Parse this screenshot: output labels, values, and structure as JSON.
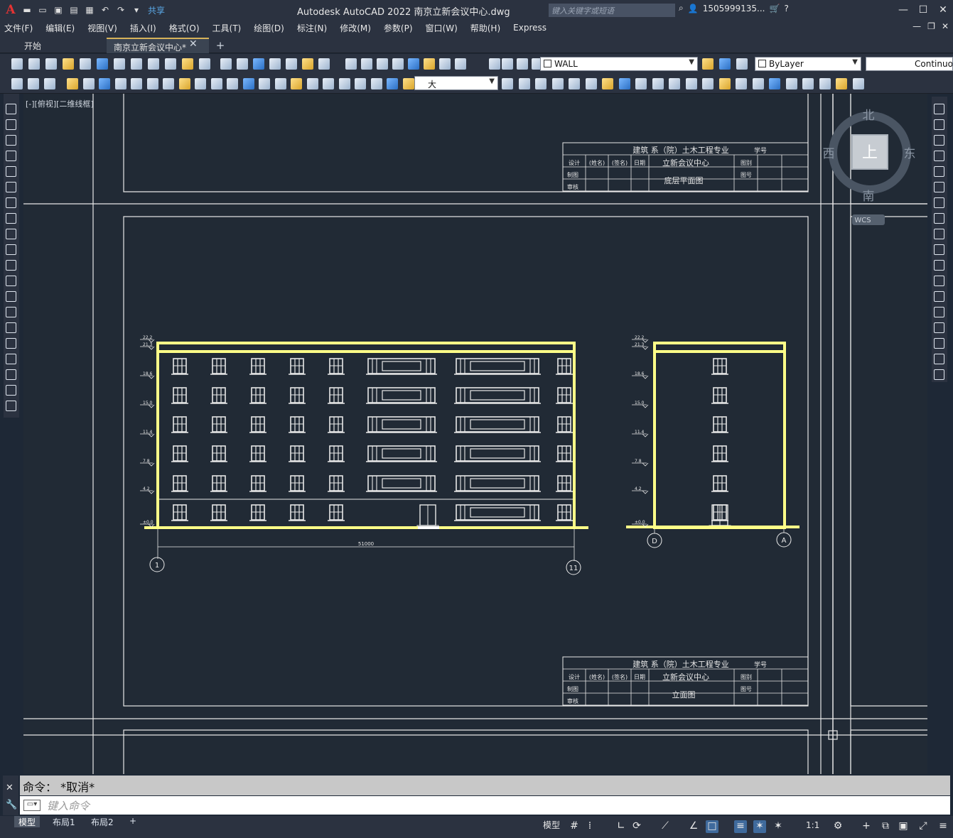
{
  "window": {
    "title": "Autodesk AutoCAD 2022    南京立新会议中心.dwg",
    "search_placeholder": "键入关键字或短语",
    "user": "1505999135...",
    "share": "共享"
  },
  "menu": [
    "文件(F)",
    "编辑(E)",
    "视图(V)",
    "插入(I)",
    "格式(O)",
    "工具(T)",
    "绘图(D)",
    "标注(N)",
    "修改(M)",
    "参数(P)",
    "窗口(W)",
    "帮助(H)",
    "Express"
  ],
  "tabs": {
    "start": "开始",
    "active": "南京立新会议中心*"
  },
  "toolbar": {
    "layer": "WALL",
    "color": "ByLayer",
    "linetype": "Continuo",
    "textstyle": "大"
  },
  "viewport": {
    "label": "[-][俯视][二维线框]"
  },
  "viewcube": {
    "north": "北",
    "south": "南",
    "east": "东",
    "west": "西",
    "top": "上",
    "wcs": "WCS"
  },
  "titleblock_top": {
    "org": "建筑  系（院）土木工程专业",
    "student": "学号",
    "r1": [
      "设计",
      "(姓名)",
      "(签名)",
      "日期"
    ],
    "project": "立新会议中心",
    "sheet": "底层平面图",
    "r2": "制图",
    "r3": "审核",
    "c1": "图别",
    "c2": "图号"
  },
  "titleblock_bottom": {
    "org": "建筑  系（院）土木工程专业",
    "student": "学号",
    "r1": [
      "设计",
      "(姓名)",
      "(签名)",
      "日期"
    ],
    "project": "立新会议中心",
    "sheet": "立面图",
    "r2": "制图",
    "r3": "审核",
    "c1": "图别",
    "c2": "图号"
  },
  "elevation": {
    "dim": "51000",
    "axis_left": "1",
    "axis_right": "11",
    "axis_d": "D",
    "axis_a": "A",
    "levels": [
      "22.2",
      "21.3",
      "18.6",
      "15.0",
      "11.4",
      "7.8",
      "4.2",
      "±0.0"
    ]
  },
  "command": {
    "history": "命令： *取消*",
    "input_placeholder": "键入命令"
  },
  "status": {
    "layouts": [
      "模型",
      "布局1",
      "布局2"
    ],
    "model": "模型",
    "scale": "1:1"
  }
}
